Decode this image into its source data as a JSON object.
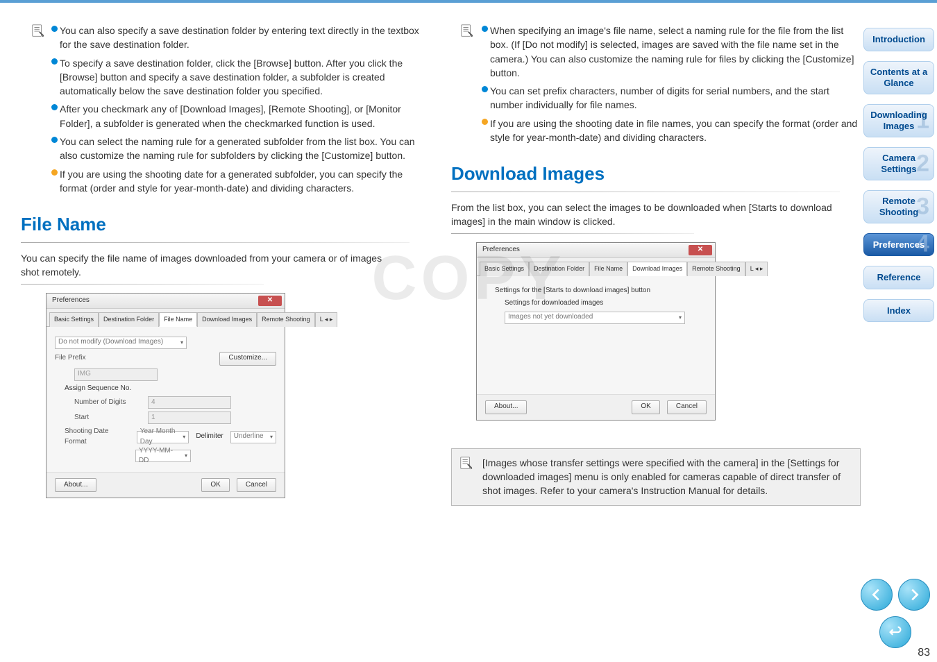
{
  "page_number": "83",
  "watermark": "COPY",
  "left": {
    "bullets": [
      "You can also specify a save destination folder by entering text directly in the textbox for the save destination folder.",
      "To specify a save destination folder, click the [Browse] button. After you click the [Browse] button and specify a save destination folder, a subfolder is created automatically below the save destination folder you specified.",
      "After you checkmark any of [Download Images], [Remote Shooting], or [Monitor Folder], a subfolder is generated when the checkmarked function is used.",
      "You can select the naming rule for a generated subfolder from the list box. You can also customize the naming rule for subfolders by clicking the [Customize] button.",
      "If you are using the shooting date for a generated subfolder, you can specify the format (order and style for year-month-date) and dividing characters."
    ],
    "file_name_heading": "File Name",
    "file_name_desc": "You can specify the file name of images downloaded from your camera or of images shot remotely."
  },
  "right": {
    "bullets": [
      "When specifying an image's file name, select a naming rule for the file from the list box. (If [Do not modify] is selected, images are saved with the file name set in the camera.) You can also customize the naming rule for files by clicking the [Customize] button.",
      "You can set prefix characters, number of digits for serial numbers, and the start number individually for file names.",
      "If you are using the shooting date in file names, you can specify the format (order and style for year-month-date) and dividing characters."
    ],
    "dl_heading": "Download Images",
    "dl_desc": "From the list box, you can select the images to be downloaded when [Starts to download images] in the main window is clicked.",
    "infobox": "[Images whose transfer settings were specified with the camera] in the [Settings for downloaded images] menu is only enabled for cameras capable of direct transfer of shot images. Refer to your camera's Instruction Manual for details."
  },
  "dialog1": {
    "title": "Preferences",
    "tabs": [
      "Basic Settings",
      "Destination Folder",
      "File Name",
      "Download Images",
      "Remote Shooting"
    ],
    "active_tab": 2,
    "top_dropdown": "Do not modify (Download Images)",
    "customize_btn": "Customize...",
    "labels": {
      "file_prefix": "File Prefix",
      "prefix_value": "IMG",
      "assign_seq": "Assign Sequence No.",
      "num_digits": "Number of Digits",
      "num_digits_val": "4",
      "start": "Start",
      "start_val": "1",
      "shooting_date": "Shooting Date Format",
      "shooting_val1": "Year Month Day",
      "shooting_val2": "YYYY-MM-DD",
      "delimiter": "Delimiter",
      "delimiter_val": "Underline"
    },
    "footer": {
      "about": "About...",
      "ok": "OK",
      "cancel": "Cancel"
    }
  },
  "dialog2": {
    "title": "Preferences",
    "tabs": [
      "Basic Settings",
      "Destination Folder",
      "File Name",
      "Download Images",
      "Remote Shooting"
    ],
    "active_tab": 3,
    "line1": "Settings for the [Starts to download images] button",
    "line2": "Settings for downloaded images",
    "dropdown_val": "Images not yet downloaded",
    "footer": {
      "about": "About...",
      "ok": "OK",
      "cancel": "Cancel"
    }
  },
  "sidebar": {
    "intro": "Introduction",
    "contents": "Contents at a Glance",
    "downloading": "Downloading Images",
    "camera": "Camera Settings",
    "remote": "Remote Shooting",
    "prefs": "Preferences",
    "reference": "Reference",
    "index": "Index"
  }
}
